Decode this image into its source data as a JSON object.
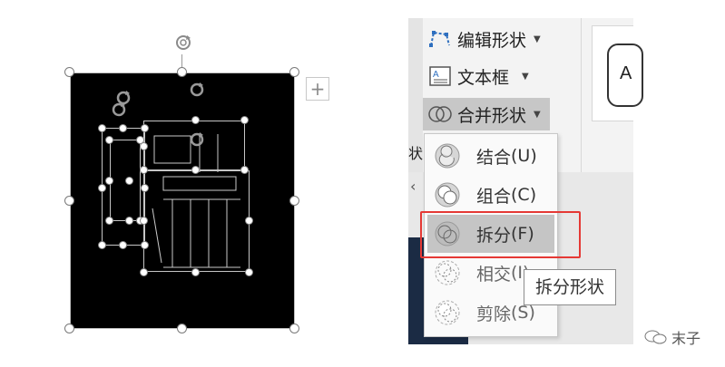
{
  "ribbon": {
    "edit_shape_label": "编辑形状",
    "textbox_label": "文本框",
    "merge_shapes_label": "合并形状",
    "gallery_letter": "A",
    "partial_label": "状"
  },
  "merge_menu": {
    "items": [
      {
        "label": "结合",
        "shortcut": "(U)"
      },
      {
        "label": "组合",
        "shortcut": "(C)"
      },
      {
        "label": "拆分",
        "shortcut": "(F)"
      },
      {
        "label": "相交",
        "shortcut": "(I)"
      },
      {
        "label": "剪除",
        "shortcut": "(S)"
      }
    ],
    "highlighted": "拆分"
  },
  "tooltip": {
    "text": "拆分形状"
  },
  "watermark": {
    "text": "末子"
  },
  "canvas": {
    "plus_label": "+"
  },
  "colors": {
    "highlight_border": "#e53935",
    "shape_fill": "#000000",
    "menu_hover": "#c5c5c5"
  }
}
